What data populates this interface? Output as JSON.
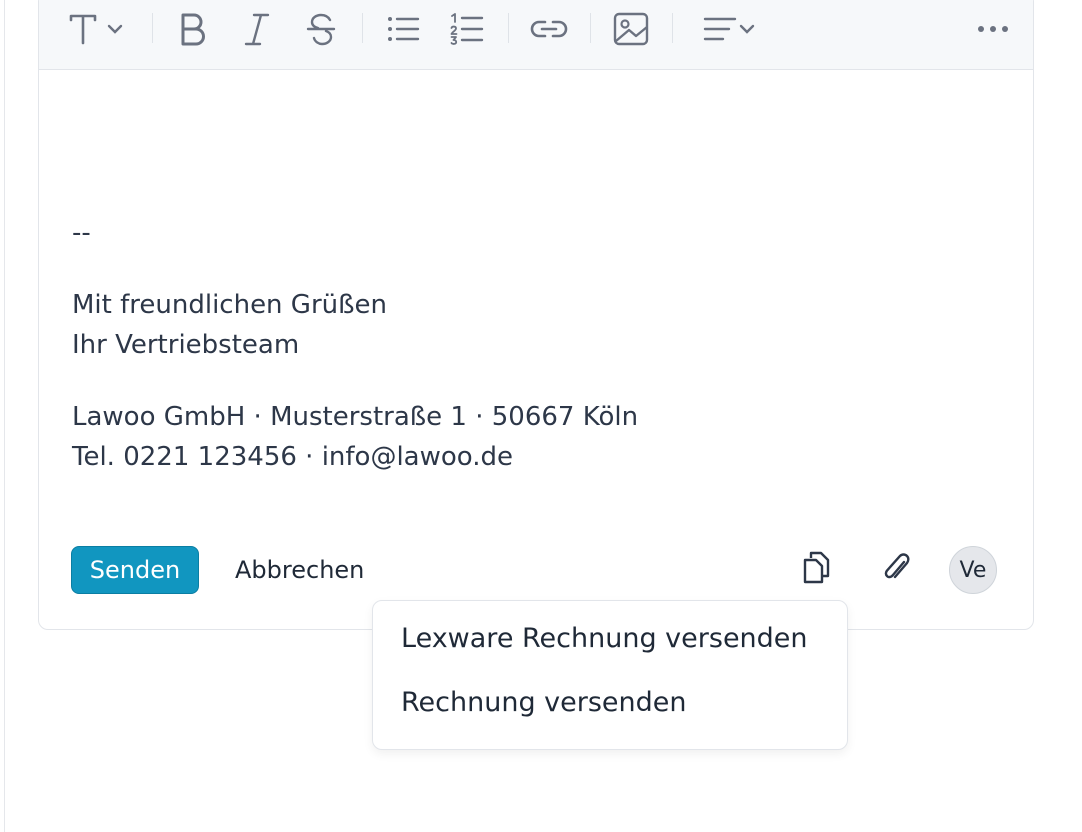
{
  "toolbar": {
    "icons": [
      "text-format-icon",
      "bold-icon",
      "italic-icon",
      "strikethrough-icon",
      "bullet-list-icon",
      "numbered-list-icon",
      "link-icon",
      "image-icon",
      "align-icon",
      "more-icon"
    ]
  },
  "editor": {
    "separator": "--",
    "greeting_line1": "Mit freundlichen Grüßen",
    "greeting_line2": "Ihr Vertriebsteam",
    "address_line1": "Lawoo GmbH · Musterstraße 1 · 50667 Köln",
    "address_line2": "Tel. 0221 123456 · info@lawoo.de"
  },
  "actions": {
    "send_label": "Senden",
    "cancel_label": "Abbrechen",
    "avatar_label": "Ve"
  },
  "dropdown": {
    "items": [
      {
        "label": "Lexware Rechnung versenden"
      },
      {
        "label": "Rechnung versenden"
      }
    ]
  },
  "colors": {
    "accent": "#1196c0",
    "text": "#2d3748",
    "toolbar_bg": "#f6f8fa"
  }
}
